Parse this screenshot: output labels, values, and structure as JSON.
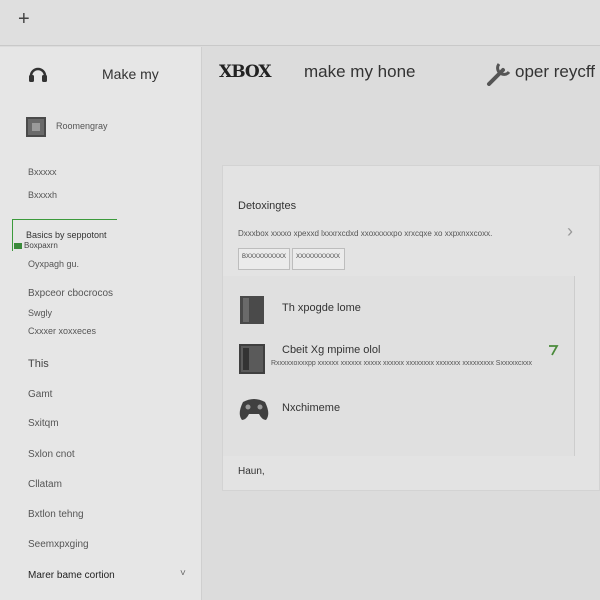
{
  "topbar": {
    "new_icon": "plus-icon",
    "new_glyph": "+"
  },
  "sidebar": {
    "title": "Make my",
    "account_label": "Roomengray",
    "items_upper": [
      "Bxxxxx",
      "Bxxxxh"
    ],
    "selected": {
      "label": "Basics by seppotont",
      "sub_label": "Boxpaxrn"
    },
    "items_lower": [
      "Oyxpagh gu.",
      "Bxpceor cbocrocos",
      "Swgly",
      "Cxxxer xoxxeces",
      "This",
      "Gamt",
      "Sxitqm",
      "Sxlon cnot",
      "Cllatam",
      "Bxtlon tehng",
      "Seemxpxging"
    ],
    "footer": "Marer bame cortion",
    "footer_chevron": "˅"
  },
  "header": {
    "logo": "XBOX",
    "title": "make my hone",
    "tool_label": "oper reycff"
  },
  "card": {
    "title": "Detoxingtes",
    "description": "Dxxxbox xxxxo xpexxd lxxxrxcdxd xxoxxxxxpo xrxcqxe xo xxpxnxxcoxx.",
    "chevron": "›",
    "tags": [
      "BXXXXXXXXXX",
      "XXXXXXXXXXX"
    ],
    "rows": [
      {
        "label": "Th xpogde lome",
        "sub": ""
      },
      {
        "label": "Cbeit Xg mpime olol",
        "sub": "Rxxxxxoxxxpp xxxxxx xxxxxx xxxxx xxxxxx xxxxxxxx xxxxxxx xxxxxxxxx Sxxxxxcxxx"
      },
      {
        "label": "Nxchimeme",
        "sub": ""
      }
    ],
    "footer": "Haun,"
  }
}
